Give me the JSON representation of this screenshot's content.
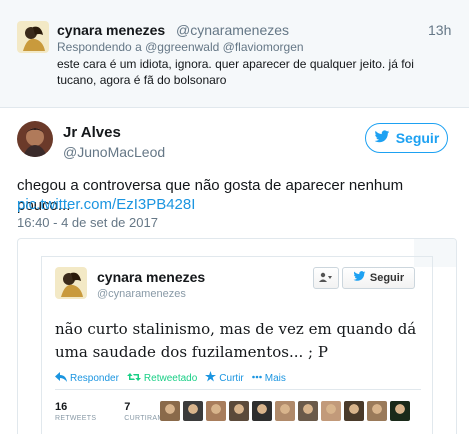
{
  "reply": {
    "name": "cynara menezes",
    "handle": "@cynaramenezes",
    "time": "13h",
    "replying_prefix": "Respondendo a",
    "replying_to": "@ggreenwald @flaviomorgen",
    "text": "este cara é um idiota, ignora. quer aparecer de qualquer jeito. já foi tucano, agora é fã do bolsonaro"
  },
  "tweet": {
    "name": "Jr Alves",
    "handle": "@JunoMacLeod",
    "follow_label": "Seguir",
    "text": "chegou a controversa que não gosta de aparecer nenhum pouco...",
    "link": "pic.twitter.com/EzI3PB428I",
    "timestamp": "16:40 - 4 de set de 2017"
  },
  "embedded": {
    "name": "cynara menezes",
    "handle": "@cynaramenezes",
    "follow_label": "Seguir",
    "text": "não curto stalinismo, mas de vez em quando dá uma saudade dos fuzilamentos... ; P",
    "actions": {
      "reply": "Responder",
      "retweeted": "Retweetado",
      "like": "Curtir",
      "more": "Mais"
    },
    "stats": {
      "retweets_count": "16",
      "retweets_label": "RETWEETS",
      "likes_count": "7",
      "likes_label": "CURTIRAM"
    },
    "face_colors": [
      "#8a6a4a",
      "#3b3b3b",
      "#a87d5c",
      "#5b4a3a",
      "#2e2e2e",
      "#b08a6a",
      "#6a5a4a",
      "#c29a7a",
      "#4a3a2a",
      "#9a7a5a",
      "#1a2a1a"
    ]
  },
  "colors": {
    "accent": "#1da1f2",
    "link": "#1b95e0",
    "retweet_green": "#19cf86",
    "muted": "#657786"
  }
}
